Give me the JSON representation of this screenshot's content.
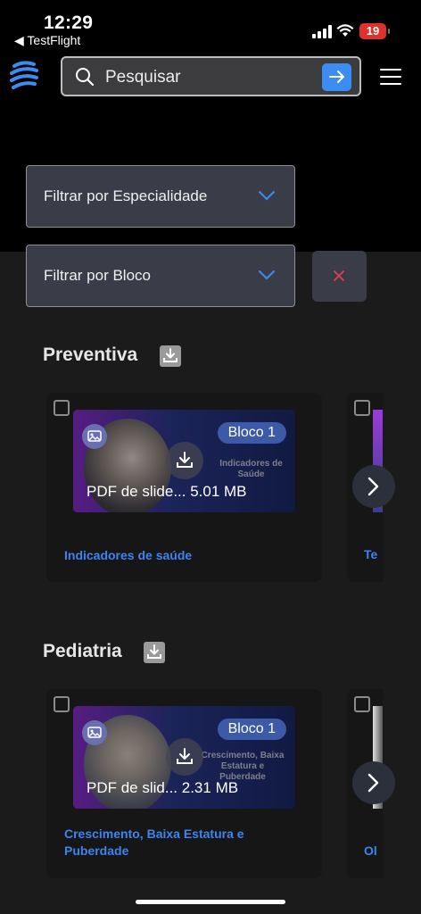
{
  "status_bar": {
    "time": "12:29",
    "back_app": "◀ TestFlight",
    "battery": "19"
  },
  "header": {
    "search_placeholder": "Pesquisar"
  },
  "filters": {
    "specialty_label": "Filtrar por Especialidade",
    "block_label": "Filtrar por Bloco"
  },
  "sections": [
    {
      "title": "Preventiva",
      "card": {
        "badge": "Bloco 1",
        "file_info": "PDF de slide... 5.01 MB",
        "slide_text": "Indicadores de Saúde",
        "title": "Indicadores de saúde"
      },
      "peek_title": "Te"
    },
    {
      "title": "Pediatria",
      "card": {
        "badge": "Bloco 1",
        "file_info": "PDF de slid... 2.31 MB",
        "slide_text": "Crescimento, Baixa Estatura e Puberdade",
        "title": "Crescimento, Baixa Estatura e Puberdade"
      },
      "peek_title": "Ol"
    }
  ],
  "colors": {
    "accent": "#3b8df1",
    "link": "#3e84f0",
    "clear_x": "#e0404a",
    "background": "#1b1b1b"
  },
  "icons": [
    "search-icon",
    "arrow-right-icon",
    "hamburger-menu-icon",
    "chevron-down-icon",
    "close-icon",
    "download-icon",
    "image-icon",
    "chevron-right-icon"
  ]
}
